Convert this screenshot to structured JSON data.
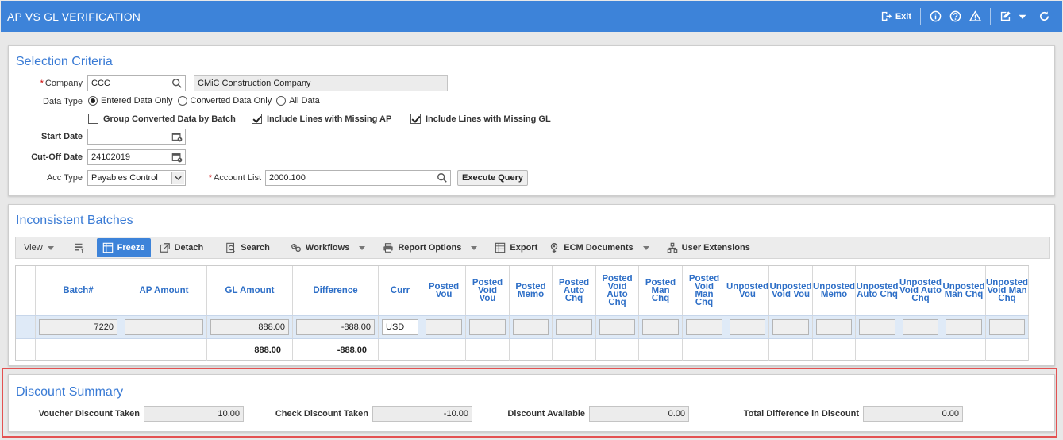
{
  "title": "AP VS GL VERIFICATION",
  "header_tools": {
    "exit_label": "Exit"
  },
  "selection": {
    "title": "Selection Criteria",
    "company_label": "Company",
    "company_value": "CCC",
    "company_name": "CMiC Construction Company",
    "data_type_label": "Data Type",
    "data_type_options": [
      "Entered Data Only",
      "Converted Data Only",
      "All Data"
    ],
    "group_converted_label": "Group Converted Data by Batch",
    "include_missing_ap_label": "Include Lines with Missing AP",
    "include_missing_gl_label": "Include Lines with Missing GL",
    "start_date_label": "Start Date",
    "start_date_value": "",
    "cutoff_label": "Cut-Off Date",
    "cutoff_value": "24102019",
    "acc_type_label": "Acc Type",
    "acc_type_value": "Payables Control",
    "account_list_label": "Account List",
    "account_list_value": "2000.100",
    "execute_label": "Execute Query"
  },
  "batches": {
    "title": "Inconsistent Batches",
    "toolbar": {
      "view": "View",
      "freeze": "Freeze",
      "detach": "Detach",
      "search": "Search",
      "workflows": "Workflows",
      "report_options": "Report Options",
      "export": "Export",
      "ecm_documents": "ECM Documents",
      "user_extensions": "User Extensions"
    },
    "columns": [
      "Batch#",
      "AP Amount",
      "GL Amount",
      "Difference",
      "Curr"
    ],
    "wrapped_columns": [
      [
        "Posted",
        "Vou"
      ],
      [
        "Posted",
        "Void",
        "Vou"
      ],
      [
        "Posted",
        "Memo"
      ],
      [
        "Posted",
        "Auto",
        "Chq"
      ],
      [
        "Posted",
        "Void",
        "Auto",
        "Chq"
      ],
      [
        "Posted",
        "Man",
        "Chq"
      ],
      [
        "Posted",
        "Void",
        "Man",
        "Chq"
      ],
      [
        "Unposted",
        "Vou"
      ],
      [
        "Unposted",
        "Void Vou"
      ],
      [
        "Unposted",
        "Memo"
      ],
      [
        "Unposted",
        "Auto Chq"
      ],
      [
        "Unposted",
        "Void Auto",
        "Chq"
      ],
      [
        "Unposted",
        "Man Chq"
      ],
      [
        "Unposted",
        "Void Man",
        "Chq"
      ]
    ],
    "row": {
      "batch": "7220",
      "ap_amount": "",
      "gl_amount": "888.00",
      "difference": "-888.00",
      "curr": "USD"
    },
    "totals": {
      "gl_amount": "888.00",
      "difference": "-888.00"
    }
  },
  "discount": {
    "title": "Discount Summary",
    "voucher_label": "Voucher Discount Taken",
    "voucher_value": "10.00",
    "check_label": "Check Discount Taken",
    "check_value": "-10.00",
    "available_label": "Discount Available",
    "available_value": "0.00",
    "total_label": "Total Difference in Discount",
    "total_value": "0.00"
  },
  "colors": {
    "header_blue": "#3d83d9",
    "title_blue": "#3a7bd5",
    "highlight_red": "#e35151"
  }
}
